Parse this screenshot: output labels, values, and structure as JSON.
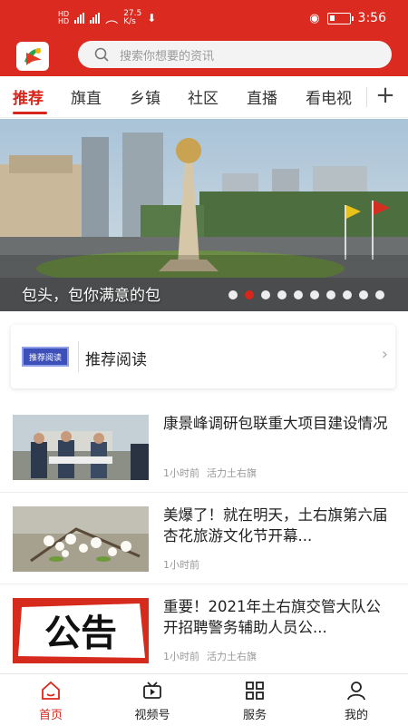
{
  "status_bar": {
    "network_speed": "27.5\nK/s",
    "time": "3:56"
  },
  "search": {
    "placeholder": "搜索你想要的资讯"
  },
  "tabs": [
    {
      "label": "推荐",
      "active": true
    },
    {
      "label": "旗直"
    },
    {
      "label": "乡镇"
    },
    {
      "label": "社区"
    },
    {
      "label": "直播"
    },
    {
      "label": "看电视"
    }
  ],
  "banner": {
    "caption": "包头，包你满意的包",
    "dot_count": 10,
    "active_dot": 1
  },
  "recommend": {
    "badge": "推荐阅读",
    "label": "推荐阅读"
  },
  "news": [
    {
      "title": "康景峰调研包联重大项目建设情况",
      "time": "1小时前",
      "source": "活力土右旗"
    },
    {
      "title": "美爆了！就在明天，土右旗第六届杏花旅游文化节开幕...",
      "time": "1小时前",
      "source": ""
    },
    {
      "title": "重要！2021年土右旗交管大队公开招聘警务辅助人员公...",
      "time": "1小时前",
      "source": "活力土右旗",
      "thumb_text": "公告"
    }
  ],
  "bottom_nav": [
    {
      "label": "首页",
      "icon": "home-icon",
      "active": true
    },
    {
      "label": "视频号",
      "icon": "video-icon"
    },
    {
      "label": "服务",
      "icon": "grid-icon"
    },
    {
      "label": "我的",
      "icon": "user-icon"
    }
  ],
  "colors": {
    "brand_red": "#db2b20",
    "active_red": "#d8261b"
  }
}
